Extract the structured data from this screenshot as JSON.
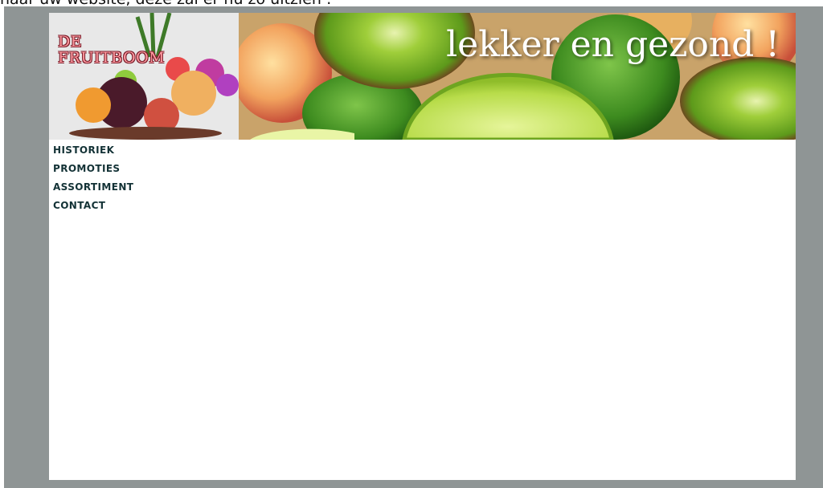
{
  "caption": "naar uw website, deze zal er nu zo uitzien :",
  "header": {
    "logo_text": "DE\nFRUITBOOM",
    "slogan": "lekker en gezond !"
  },
  "nav": {
    "items": [
      {
        "label": "HISTORIEK"
      },
      {
        "label": "PROMOTIES"
      },
      {
        "label": "ASSORTIMENT"
      },
      {
        "label": "CONTACT"
      }
    ]
  },
  "colors": {
    "frame": "#8f9595",
    "nav_text": "#133236",
    "logo_text": "#ff9aa0"
  }
}
